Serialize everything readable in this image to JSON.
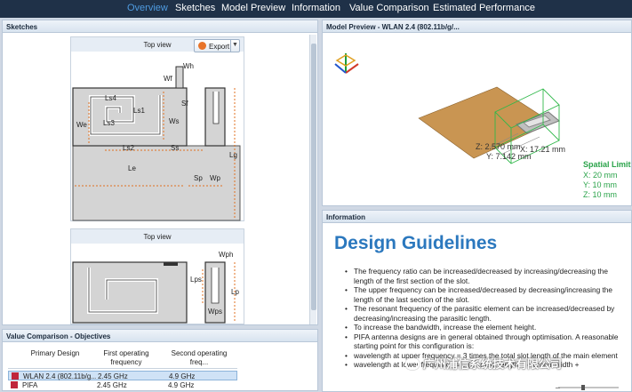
{
  "nav": {
    "tabs": [
      {
        "label": "Overview",
        "active": true
      },
      {
        "label": "Sketches"
      },
      {
        "label": "Model Preview"
      },
      {
        "label": "Information"
      },
      {
        "label": "Value Comparison"
      },
      {
        "label": "Estimated Performance"
      }
    ]
  },
  "sketches": {
    "header": "Sketches",
    "top_view_1": "Top view",
    "top_view_2": "Top view",
    "export_label": "Export",
    "labels": {
      "wh": "Wh",
      "wf": "Wf",
      "sf": "Sf",
      "ls4": "Ls4",
      "ls1": "Ls1",
      "ls3": "Ls3",
      "ws": "Ws",
      "we": "We",
      "ls2": "Ls2",
      "ss": "Ss",
      "le": "Le",
      "sp": "Sp",
      "wp": "Wp",
      "lg": "Lg",
      "wph": "Wph",
      "lps": "Lps",
      "lp": "Lp",
      "wps": "Wps"
    }
  },
  "value_comparison": {
    "header": "Value Comparison - Objectives",
    "columns": [
      "Primary Design",
      "First operating frequency",
      "Second operating freq..."
    ],
    "rows": [
      {
        "name": "WLAN 2.4 (802.11b/g...",
        "first": "2.45 GHz",
        "second": "4.9 GHz",
        "color": "#c0263c",
        "selected": true
      },
      {
        "name": "PIFA",
        "first": "2.45 GHz",
        "second": "4.9 GHz",
        "color": "#c0263c",
        "selected": false
      }
    ]
  },
  "model_preview": {
    "header": "Model Preview  -  WLAN 2.4 (802.11b/g/...",
    "dim_x": "X: 17.21 mm",
    "dim_y": "Y: 7.142 mm",
    "dim_z": "Z: 2.570 mm",
    "spatial_title": "Spatial Limit",
    "spatial_x": "X: 20 mm",
    "spatial_y": "Y: 10 mm",
    "spatial_z": "Z: 10 mm"
  },
  "information": {
    "header": "Information",
    "title": "Design Guidelines",
    "bullets": [
      "The frequency ratio can be increased/decreased by increasing/decreasing the length of the first section of the slot.",
      "The upper frequency can be increased/decreased by decreasing/increasing the length of the last section of the slot.",
      "The resonant frequency of the parasitic element can be increased/decreased by decreasing/increasing the parasitic length.",
      "To increase the bandwidth, increase the element height.",
      "PIFA antenna designs are in general obtained through optimisation. A reasonable starting point for this configuration is:",
      "wavelength at upper frequency = 3 times the total slot length of the main element",
      "wavelength at lower frequency = 5 (element length + element width +"
    ]
  },
  "watermark": "广州浦信系统技术有限公司"
}
